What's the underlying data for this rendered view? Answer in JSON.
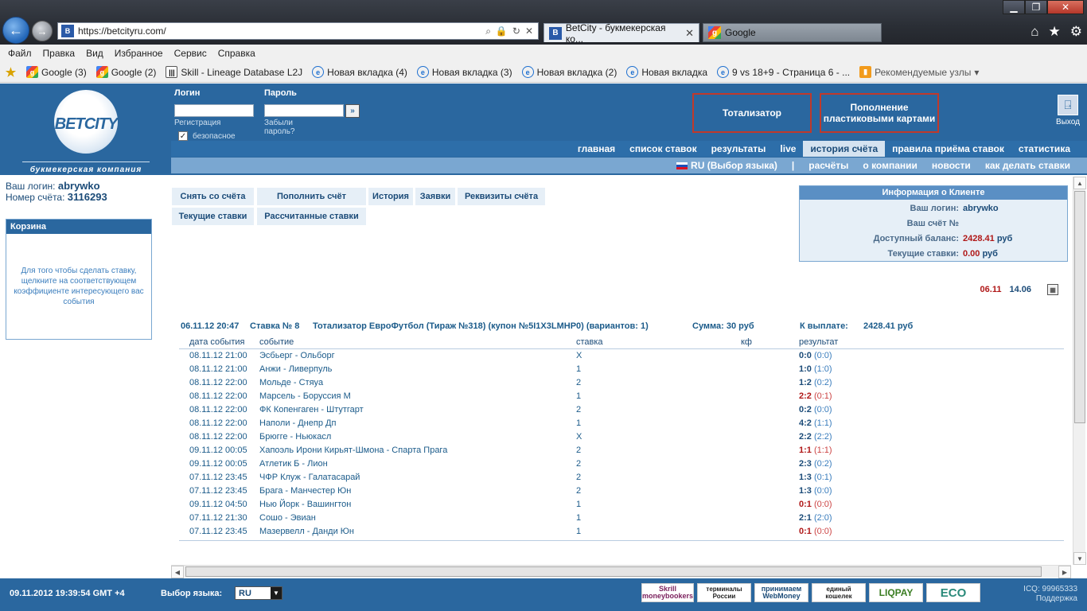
{
  "browser": {
    "url": "https://betcityru.com/",
    "tabs": [
      {
        "label": "BetCity - букмекерская ко...",
        "active": true
      },
      {
        "label": "Google",
        "active": false
      }
    ],
    "menu": [
      "Файл",
      "Правка",
      "Вид",
      "Избранное",
      "Сервис",
      "Справка"
    ],
    "favorites": [
      {
        "label": "Google (3)",
        "icon": "google-icon"
      },
      {
        "label": "Google (2)",
        "icon": "google-icon"
      },
      {
        "label": "Skill - Lineage Database L2J",
        "icon": "skill-icon"
      },
      {
        "label": "Новая вкладка (4)",
        "icon": "ie-page-icon"
      },
      {
        "label": "Новая вкладка (3)",
        "icon": "ie-page-icon"
      },
      {
        "label": "Новая вкладка (2)",
        "icon": "ie-page-icon"
      },
      {
        "label": "Новая вкладка",
        "icon": "ie-page-icon"
      },
      {
        "label": "9 vs 18+9 - Страница 6 - ...",
        "icon": "ie-page-icon"
      },
      {
        "label": "Рекомендуемые узлы",
        "icon": "recommended-icon"
      }
    ]
  },
  "header": {
    "logo_text": "BETCITY",
    "logo_sub": "букмекерская компания",
    "login_label": "Логин",
    "password_label": "Пароль",
    "register": "Регистрация",
    "forgot": "Забыли пароль?",
    "secure": "безопасное соединение",
    "totalizator": "Тотализатор",
    "topup": "Пополнение пластиковыми картами",
    "exit": "Выход"
  },
  "nav_main": [
    "главная",
    "список ставок",
    "результаты",
    "live",
    "история счёта",
    "правила приёма ставок",
    "статистика"
  ],
  "nav_main_active": "история счёта",
  "nav_sub": {
    "lang": "RU (Выбор языка)",
    "sep": "|",
    "items": [
      "расчёты",
      "о компании",
      "новости",
      "как делать ставки"
    ]
  },
  "user": {
    "login_label": "Ваш логин:",
    "login": "abrywko",
    "account_label": "Номер счёта:",
    "account": "3116293"
  },
  "basket": {
    "title": "Корзина",
    "text": "Для того чтобы сделать ставку, щелкните на соответствующем коэффициенте интересующего вас события"
  },
  "actions": {
    "withdraw": "Снять со счёта",
    "deposit": "Пополнить счёт",
    "history": "История",
    "requests": "Заявки",
    "requisites": "Реквизиты счёта",
    "current": "Текущие ставки",
    "settled": "Рассчитанные ставки"
  },
  "client": {
    "title": "Информация о Клиенте",
    "login_label": "Ваш логин:",
    "login": "abrywko",
    "account_label": "Ваш счёт №",
    "balance_label": "Доступный баланс:",
    "balance": "2428.41",
    "currency": "руб",
    "current_label": "Текущие ставки:",
    "current": "0.00"
  },
  "dates": {
    "from": "06.11",
    "to": "14.06"
  },
  "bet": {
    "datetime": "06.11.12 20:47",
    "number": "Ставка № 8",
    "desc": "Тотализатор ЕвроФутбол (Тираж №318) (купон №5I1X3LMHP0) (вариантов: 1)",
    "sum": "Сумма: 30 руб",
    "payout_label": "К выплате:",
    "payout": "2428.41 руб"
  },
  "table": {
    "headers": [
      "дата события",
      "событие",
      "ставка",
      "кф",
      "результат"
    ],
    "rows": [
      {
        "date": "08.11.12 21:00",
        "event": "Эсбьерг - Ольборг",
        "bet": "X",
        "score": "0:0",
        "half": "(0:0)",
        "win": true
      },
      {
        "date": "08.11.12 21:00",
        "event": "Анжи - Ливерпуль",
        "bet": "1",
        "score": "1:0",
        "half": "(1:0)",
        "win": true
      },
      {
        "date": "08.11.12 22:00",
        "event": "Мольде - Стяуа",
        "bet": "2",
        "score": "1:2",
        "half": "(0:2)",
        "win": true
      },
      {
        "date": "08.11.12 22:00",
        "event": "Марсель - Боруссия М",
        "bet": "1",
        "score": "2:2",
        "half": "(0:1)",
        "win": false
      },
      {
        "date": "08.11.12 22:00",
        "event": "ФК Копенгаген - Штутгарт",
        "bet": "2",
        "score": "0:2",
        "half": "(0:0)",
        "win": true
      },
      {
        "date": "08.11.12 22:00",
        "event": "Наполи - Днепр Дп",
        "bet": "1",
        "score": "4:2",
        "half": "(1:1)",
        "win": true
      },
      {
        "date": "08.11.12 22:00",
        "event": "Брюгге - Ньюкасл",
        "bet": "X",
        "score": "2:2",
        "half": "(2:2)",
        "win": true
      },
      {
        "date": "09.11.12 00:05",
        "event": "Хапоэль Ирони Кирьят-Шмона - Спарта Прага",
        "bet": "2",
        "score": "1:1",
        "half": "(1:1)",
        "win": false
      },
      {
        "date": "09.11.12 00:05",
        "event": "Атлетик Б - Лион",
        "bet": "2",
        "score": "2:3",
        "half": "(0:2)",
        "win": true
      },
      {
        "date": "07.11.12 23:45",
        "event": "ЧФР Клуж - Галатасарай",
        "bet": "2",
        "score": "1:3",
        "half": "(0:1)",
        "win": true
      },
      {
        "date": "07.11.12 23:45",
        "event": "Брага - Манчестер Юн",
        "bet": "2",
        "score": "1:3",
        "half": "(0:0)",
        "win": true
      },
      {
        "date": "09.11.12 04:50",
        "event": "Нью Йорк - Вашингтон",
        "bet": "1",
        "score": "0:1",
        "half": "(0:0)",
        "win": false
      },
      {
        "date": "07.11.12 21:30",
        "event": "Сошо - Эвиан",
        "bet": "1",
        "score": "2:1",
        "half": "(2:0)",
        "win": true
      },
      {
        "date": "07.11.12 23:45",
        "event": "Мазервелл - Данди Юн",
        "bet": "1",
        "score": "0:1",
        "half": "(0:0)",
        "win": false
      }
    ]
  },
  "footer": {
    "datetime": "09.11.2012 19:39:54 GMT +4",
    "lang_label": "Выбор языка:",
    "lang_value": "RU",
    "payments": [
      "Skrill moneybookers",
      "терминалы России",
      "принимаем WebMoney",
      "единый кошелек",
      "LIQPAY",
      "ECO"
    ],
    "icq": "ICQ: 99965333",
    "support": "Поддержка"
  },
  "colors": {
    "header_blue": "#2a679f",
    "nav_light": "#7aa7d1",
    "loss_red": "#b01818"
  }
}
